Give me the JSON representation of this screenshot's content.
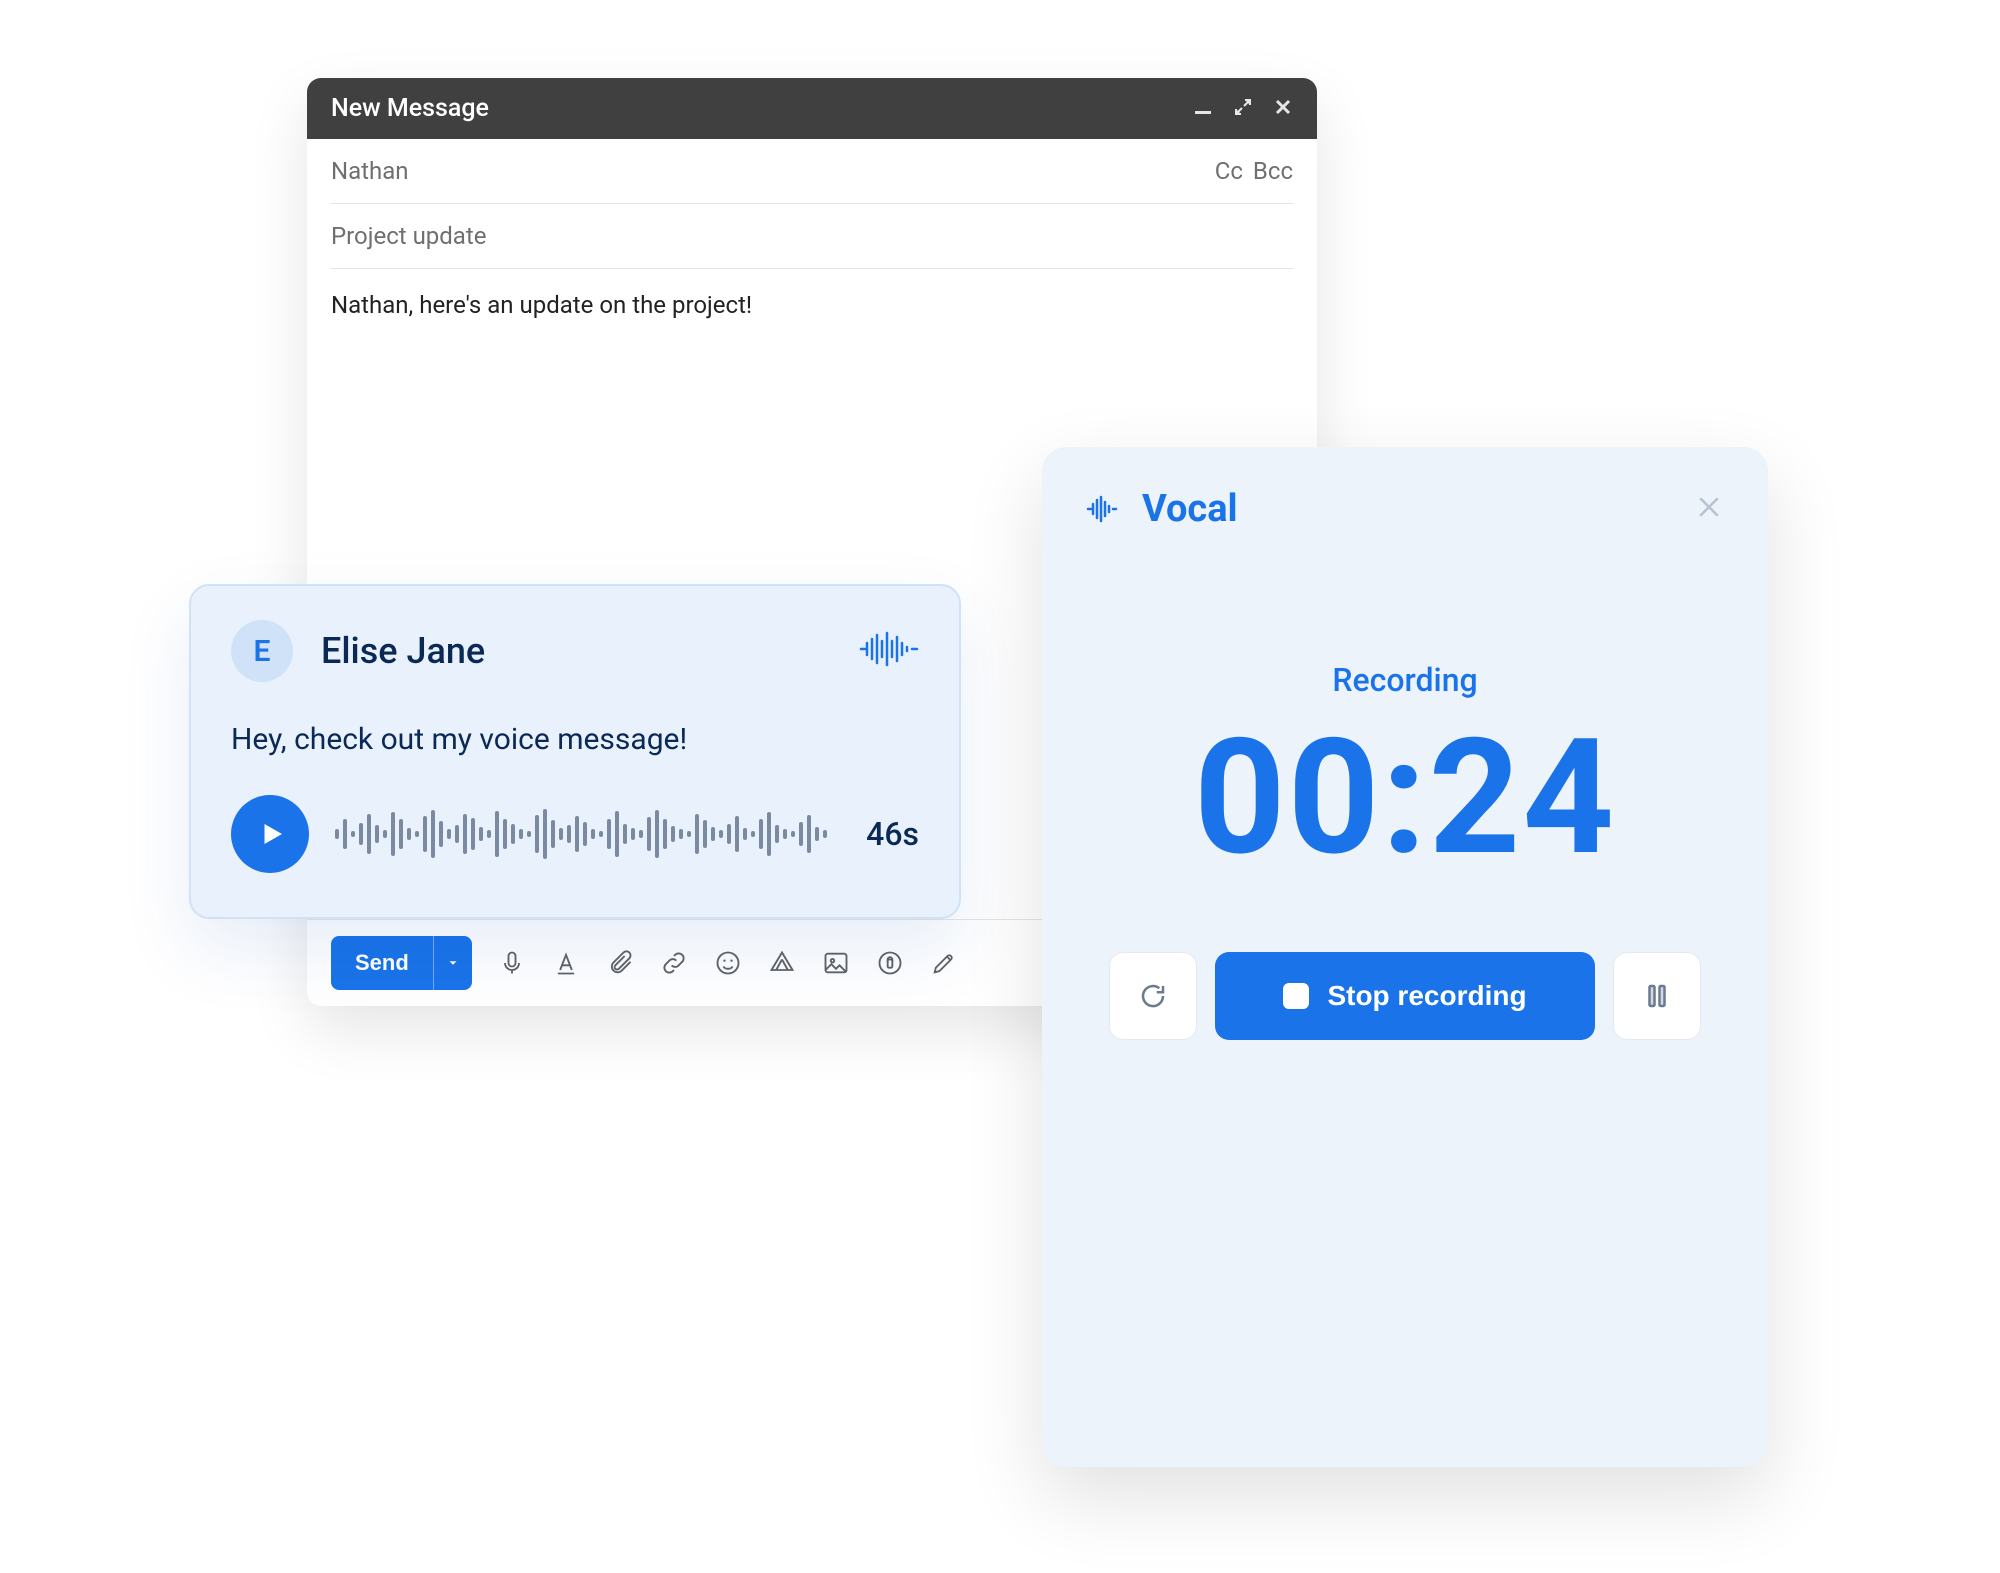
{
  "compose": {
    "title": "New Message",
    "to": "Nathan",
    "cc_label": "Cc",
    "bcc_label": "Bcc",
    "subject": "Project update",
    "body": "Nathan, here's an update on the project!",
    "send_label": "Send"
  },
  "voice_card": {
    "avatar_initial": "E",
    "name": "Elise Jane",
    "message": "Hey, check out my voice message!",
    "duration_label": "46s"
  },
  "recorder": {
    "brand": "Vocal",
    "status": "Recording",
    "timer": "00:24",
    "stop_label": "Stop recording"
  },
  "colors": {
    "accent": "#1a73e8",
    "panel": "#edf3fb",
    "card": "#e9f1fc"
  }
}
